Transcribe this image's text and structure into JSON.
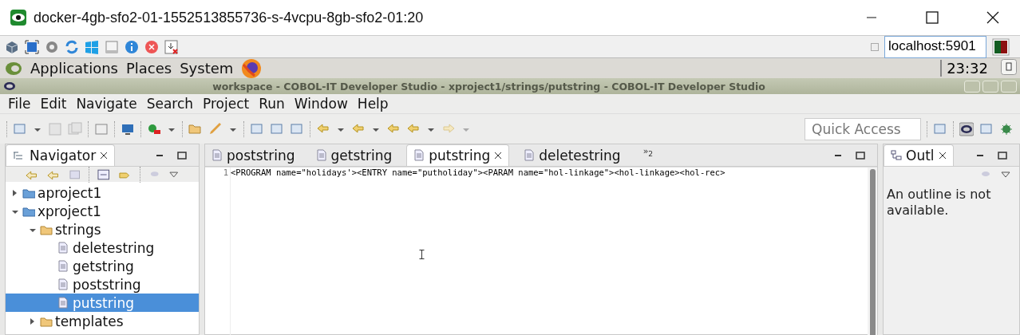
{
  "window": {
    "title": "docker-4gb-sfo2-01-1552513855736-s-4vcpu-8gb-sfo2-01:20"
  },
  "vnc_toolbar": {
    "host": "localhost:5901"
  },
  "desktop_panel": {
    "menus": [
      "Applications",
      "Places",
      "System"
    ],
    "clock": "23:32"
  },
  "ide": {
    "title": "workspace - COBOL-IT Developer Studio - xproject1/strings/putstring - COBOL-IT Developer Studio",
    "menu": [
      "File",
      "Edit",
      "Navigate",
      "Search",
      "Project",
      "Run",
      "Window",
      "Help"
    ],
    "quick_access": {
      "placeholder": "Quick Access"
    },
    "navigator": {
      "title": "Navigator",
      "tree": [
        {
          "label": "aproject1",
          "kind": "project",
          "expanded": false,
          "selected": false
        },
        {
          "label": "xproject1",
          "kind": "project",
          "expanded": true,
          "selected": false,
          "children": [
            {
              "label": "strings",
              "kind": "folder",
              "expanded": true,
              "selected": false,
              "children": [
                {
                  "label": "deletestring",
                  "kind": "file",
                  "selected": false
                },
                {
                  "label": "getstring",
                  "kind": "file",
                  "selected": false
                },
                {
                  "label": "poststring",
                  "kind": "file",
                  "selected": false
                },
                {
                  "label": "putstring",
                  "kind": "file",
                  "selected": true
                }
              ]
            },
            {
              "label": "templates",
              "kind": "folder",
              "expanded": false,
              "selected": false
            }
          ]
        }
      ]
    },
    "editor": {
      "tabs": [
        {
          "label": "poststring",
          "selected": false
        },
        {
          "label": "getstring",
          "selected": false
        },
        {
          "label": "putstring",
          "selected": true
        },
        {
          "label": "deletestring",
          "selected": false
        }
      ],
      "overflow": "»$_{2}$",
      "lines": [
        {
          "number": "1",
          "text": "<PROGRAM name=\"holidays'><ENTRY name=\"putholiday\"><PARAM name=\"hol-linkage\"><hol-linkage><hol-rec>"
        }
      ]
    },
    "outline": {
      "title": "Outl",
      "message": "An outline is not available."
    }
  }
}
